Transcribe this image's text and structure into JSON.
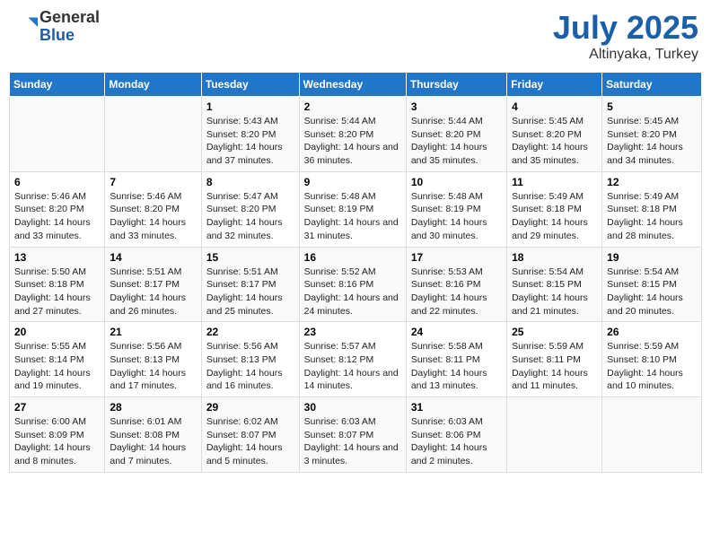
{
  "logo": {
    "general": "General",
    "blue": "Blue"
  },
  "title": {
    "month": "July 2025",
    "location": "Altinyaka, Turkey"
  },
  "days_header": [
    "Sunday",
    "Monday",
    "Tuesday",
    "Wednesday",
    "Thursday",
    "Friday",
    "Saturday"
  ],
  "weeks": [
    [
      {
        "day": "",
        "sunrise": "",
        "sunset": "",
        "daylight": ""
      },
      {
        "day": "",
        "sunrise": "",
        "sunset": "",
        "daylight": ""
      },
      {
        "day": "1",
        "sunrise": "Sunrise: 5:43 AM",
        "sunset": "Sunset: 8:20 PM",
        "daylight": "Daylight: 14 hours and 37 minutes."
      },
      {
        "day": "2",
        "sunrise": "Sunrise: 5:44 AM",
        "sunset": "Sunset: 8:20 PM",
        "daylight": "Daylight: 14 hours and 36 minutes."
      },
      {
        "day": "3",
        "sunrise": "Sunrise: 5:44 AM",
        "sunset": "Sunset: 8:20 PM",
        "daylight": "Daylight: 14 hours and 35 minutes."
      },
      {
        "day": "4",
        "sunrise": "Sunrise: 5:45 AM",
        "sunset": "Sunset: 8:20 PM",
        "daylight": "Daylight: 14 hours and 35 minutes."
      },
      {
        "day": "5",
        "sunrise": "Sunrise: 5:45 AM",
        "sunset": "Sunset: 8:20 PM",
        "daylight": "Daylight: 14 hours and 34 minutes."
      }
    ],
    [
      {
        "day": "6",
        "sunrise": "Sunrise: 5:46 AM",
        "sunset": "Sunset: 8:20 PM",
        "daylight": "Daylight: 14 hours and 33 minutes."
      },
      {
        "day": "7",
        "sunrise": "Sunrise: 5:46 AM",
        "sunset": "Sunset: 8:20 PM",
        "daylight": "Daylight: 14 hours and 33 minutes."
      },
      {
        "day": "8",
        "sunrise": "Sunrise: 5:47 AM",
        "sunset": "Sunset: 8:20 PM",
        "daylight": "Daylight: 14 hours and 32 minutes."
      },
      {
        "day": "9",
        "sunrise": "Sunrise: 5:48 AM",
        "sunset": "Sunset: 8:19 PM",
        "daylight": "Daylight: 14 hours and 31 minutes."
      },
      {
        "day": "10",
        "sunrise": "Sunrise: 5:48 AM",
        "sunset": "Sunset: 8:19 PM",
        "daylight": "Daylight: 14 hours and 30 minutes."
      },
      {
        "day": "11",
        "sunrise": "Sunrise: 5:49 AM",
        "sunset": "Sunset: 8:18 PM",
        "daylight": "Daylight: 14 hours and 29 minutes."
      },
      {
        "day": "12",
        "sunrise": "Sunrise: 5:49 AM",
        "sunset": "Sunset: 8:18 PM",
        "daylight": "Daylight: 14 hours and 28 minutes."
      }
    ],
    [
      {
        "day": "13",
        "sunrise": "Sunrise: 5:50 AM",
        "sunset": "Sunset: 8:18 PM",
        "daylight": "Daylight: 14 hours and 27 minutes."
      },
      {
        "day": "14",
        "sunrise": "Sunrise: 5:51 AM",
        "sunset": "Sunset: 8:17 PM",
        "daylight": "Daylight: 14 hours and 26 minutes."
      },
      {
        "day": "15",
        "sunrise": "Sunrise: 5:51 AM",
        "sunset": "Sunset: 8:17 PM",
        "daylight": "Daylight: 14 hours and 25 minutes."
      },
      {
        "day": "16",
        "sunrise": "Sunrise: 5:52 AM",
        "sunset": "Sunset: 8:16 PM",
        "daylight": "Daylight: 14 hours and 24 minutes."
      },
      {
        "day": "17",
        "sunrise": "Sunrise: 5:53 AM",
        "sunset": "Sunset: 8:16 PM",
        "daylight": "Daylight: 14 hours and 22 minutes."
      },
      {
        "day": "18",
        "sunrise": "Sunrise: 5:54 AM",
        "sunset": "Sunset: 8:15 PM",
        "daylight": "Daylight: 14 hours and 21 minutes."
      },
      {
        "day": "19",
        "sunrise": "Sunrise: 5:54 AM",
        "sunset": "Sunset: 8:15 PM",
        "daylight": "Daylight: 14 hours and 20 minutes."
      }
    ],
    [
      {
        "day": "20",
        "sunrise": "Sunrise: 5:55 AM",
        "sunset": "Sunset: 8:14 PM",
        "daylight": "Daylight: 14 hours and 19 minutes."
      },
      {
        "day": "21",
        "sunrise": "Sunrise: 5:56 AM",
        "sunset": "Sunset: 8:13 PM",
        "daylight": "Daylight: 14 hours and 17 minutes."
      },
      {
        "day": "22",
        "sunrise": "Sunrise: 5:56 AM",
        "sunset": "Sunset: 8:13 PM",
        "daylight": "Daylight: 14 hours and 16 minutes."
      },
      {
        "day": "23",
        "sunrise": "Sunrise: 5:57 AM",
        "sunset": "Sunset: 8:12 PM",
        "daylight": "Daylight: 14 hours and 14 minutes."
      },
      {
        "day": "24",
        "sunrise": "Sunrise: 5:58 AM",
        "sunset": "Sunset: 8:11 PM",
        "daylight": "Daylight: 14 hours and 13 minutes."
      },
      {
        "day": "25",
        "sunrise": "Sunrise: 5:59 AM",
        "sunset": "Sunset: 8:11 PM",
        "daylight": "Daylight: 14 hours and 11 minutes."
      },
      {
        "day": "26",
        "sunrise": "Sunrise: 5:59 AM",
        "sunset": "Sunset: 8:10 PM",
        "daylight": "Daylight: 14 hours and 10 minutes."
      }
    ],
    [
      {
        "day": "27",
        "sunrise": "Sunrise: 6:00 AM",
        "sunset": "Sunset: 8:09 PM",
        "daylight": "Daylight: 14 hours and 8 minutes."
      },
      {
        "day": "28",
        "sunrise": "Sunrise: 6:01 AM",
        "sunset": "Sunset: 8:08 PM",
        "daylight": "Daylight: 14 hours and 7 minutes."
      },
      {
        "day": "29",
        "sunrise": "Sunrise: 6:02 AM",
        "sunset": "Sunset: 8:07 PM",
        "daylight": "Daylight: 14 hours and 5 minutes."
      },
      {
        "day": "30",
        "sunrise": "Sunrise: 6:03 AM",
        "sunset": "Sunset: 8:07 PM",
        "daylight": "Daylight: 14 hours and 3 minutes."
      },
      {
        "day": "31",
        "sunrise": "Sunrise: 6:03 AM",
        "sunset": "Sunset: 8:06 PM",
        "daylight": "Daylight: 14 hours and 2 minutes."
      },
      {
        "day": "",
        "sunrise": "",
        "sunset": "",
        "daylight": ""
      },
      {
        "day": "",
        "sunrise": "",
        "sunset": "",
        "daylight": ""
      }
    ]
  ]
}
